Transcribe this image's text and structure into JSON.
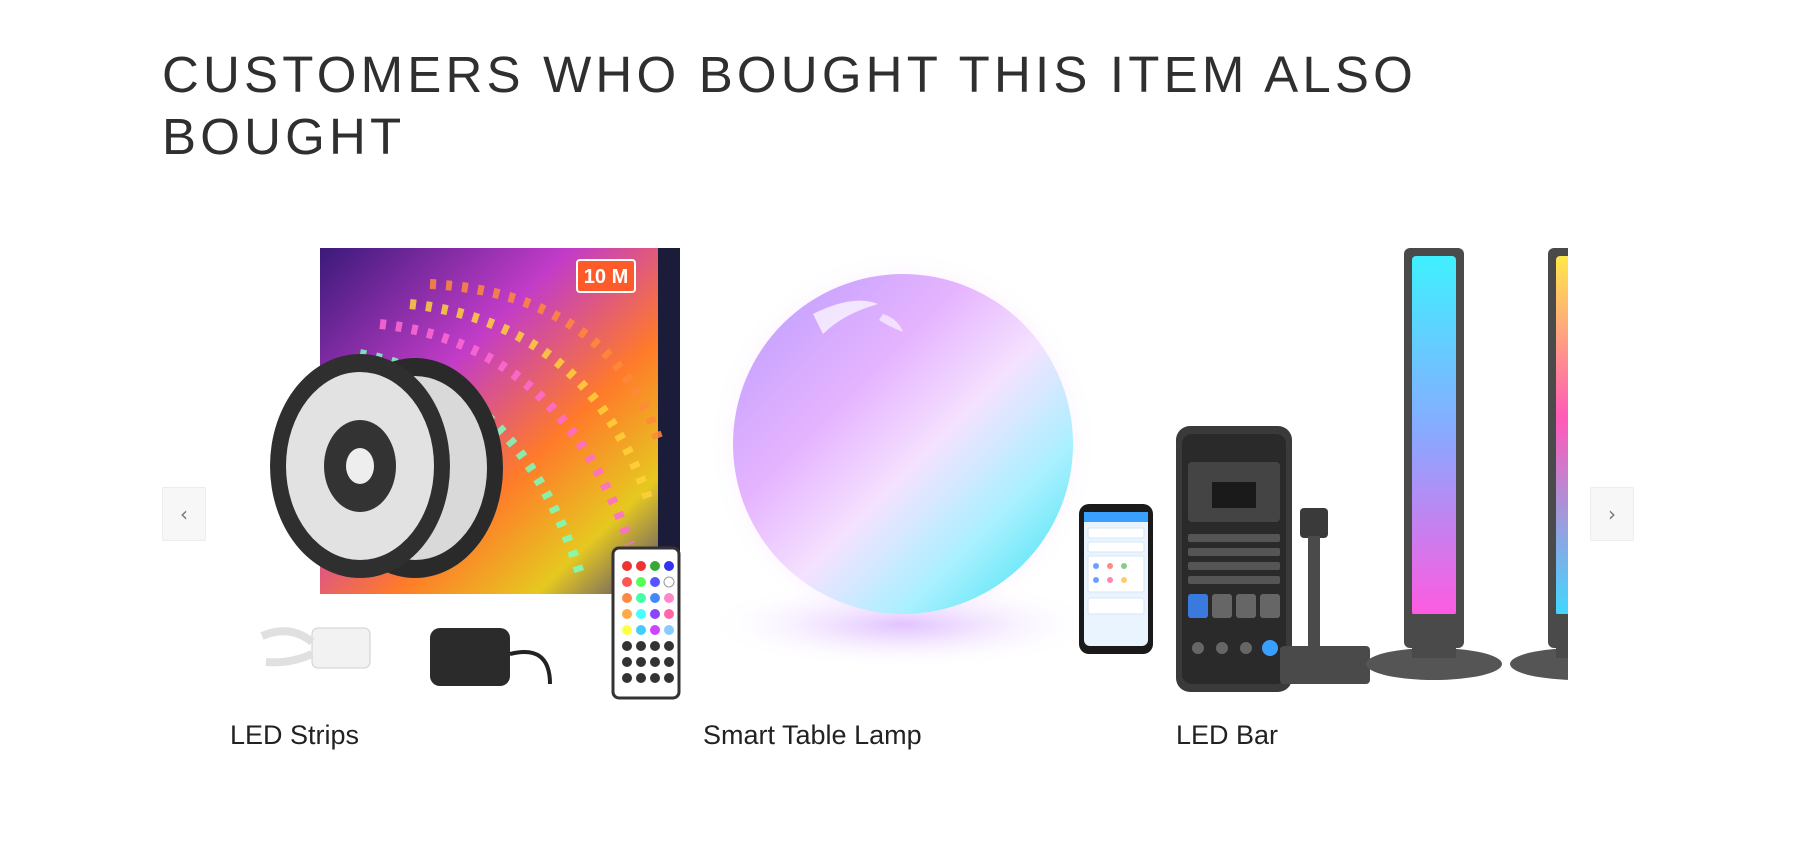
{
  "section": {
    "title": "CUSTOMERS WHO BOUGHT THIS ITEM ALSO BOUGHT"
  },
  "carousel": {
    "prev_icon": "chevron-left-icon",
    "prev_glyph": "‹",
    "next_icon": "chevron-right-icon",
    "next_glyph": "›",
    "products": [
      {
        "title": "LED Strips",
        "box_badge": "10 M",
        "image": "led-strip-reels-with-remote-and-adapter"
      },
      {
        "title": "Smart Table Lamp",
        "image": "rgb-glowing-orb-lamp"
      },
      {
        "title": "LED Bar",
        "image": "light-bars-with-phone-app"
      }
    ]
  },
  "colors": {
    "title_text": "#2f2f2f",
    "nav_bg": "#f7f7f7",
    "badge_orange": "#ff5a2a"
  }
}
